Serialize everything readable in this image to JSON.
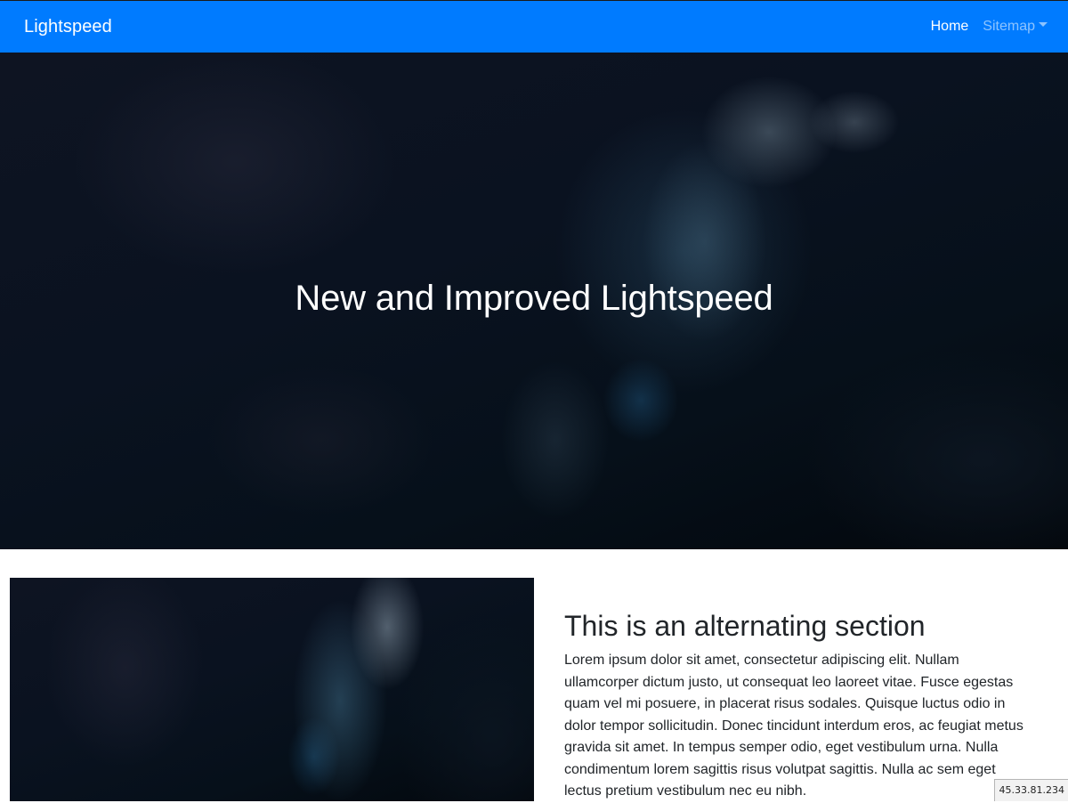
{
  "navbar": {
    "brand": "Lightspeed",
    "links": [
      {
        "label": "Home"
      },
      {
        "label": "Sitemap"
      }
    ]
  },
  "hero": {
    "title": "New and Improved Lightspeed"
  },
  "section": {
    "heading": "This is an alternating section",
    "body": "Lorem ipsum dolor sit amet, consectetur adipiscing elit. Nullam ullamcorper dictum justo, ut consequat leo laoreet vitae. Fusce egestas quam vel mi posuere, in placerat risus sodales. Quisque luctus odio in dolor tempor sollicitudin. Donec tincidunt interdum eros, ac feugiat metus gravida sit amet. In tempus semper odio, eget vestibulum urna. Nulla condimentum lorem sagittis risus volutpat sagittis. Nulla ac sem eget lectus pretium vestibulum nec eu nibh."
  },
  "status": {
    "ip": "45.33.81.234"
  },
  "colors": {
    "navbar": "#007bff",
    "text": "#212529"
  }
}
